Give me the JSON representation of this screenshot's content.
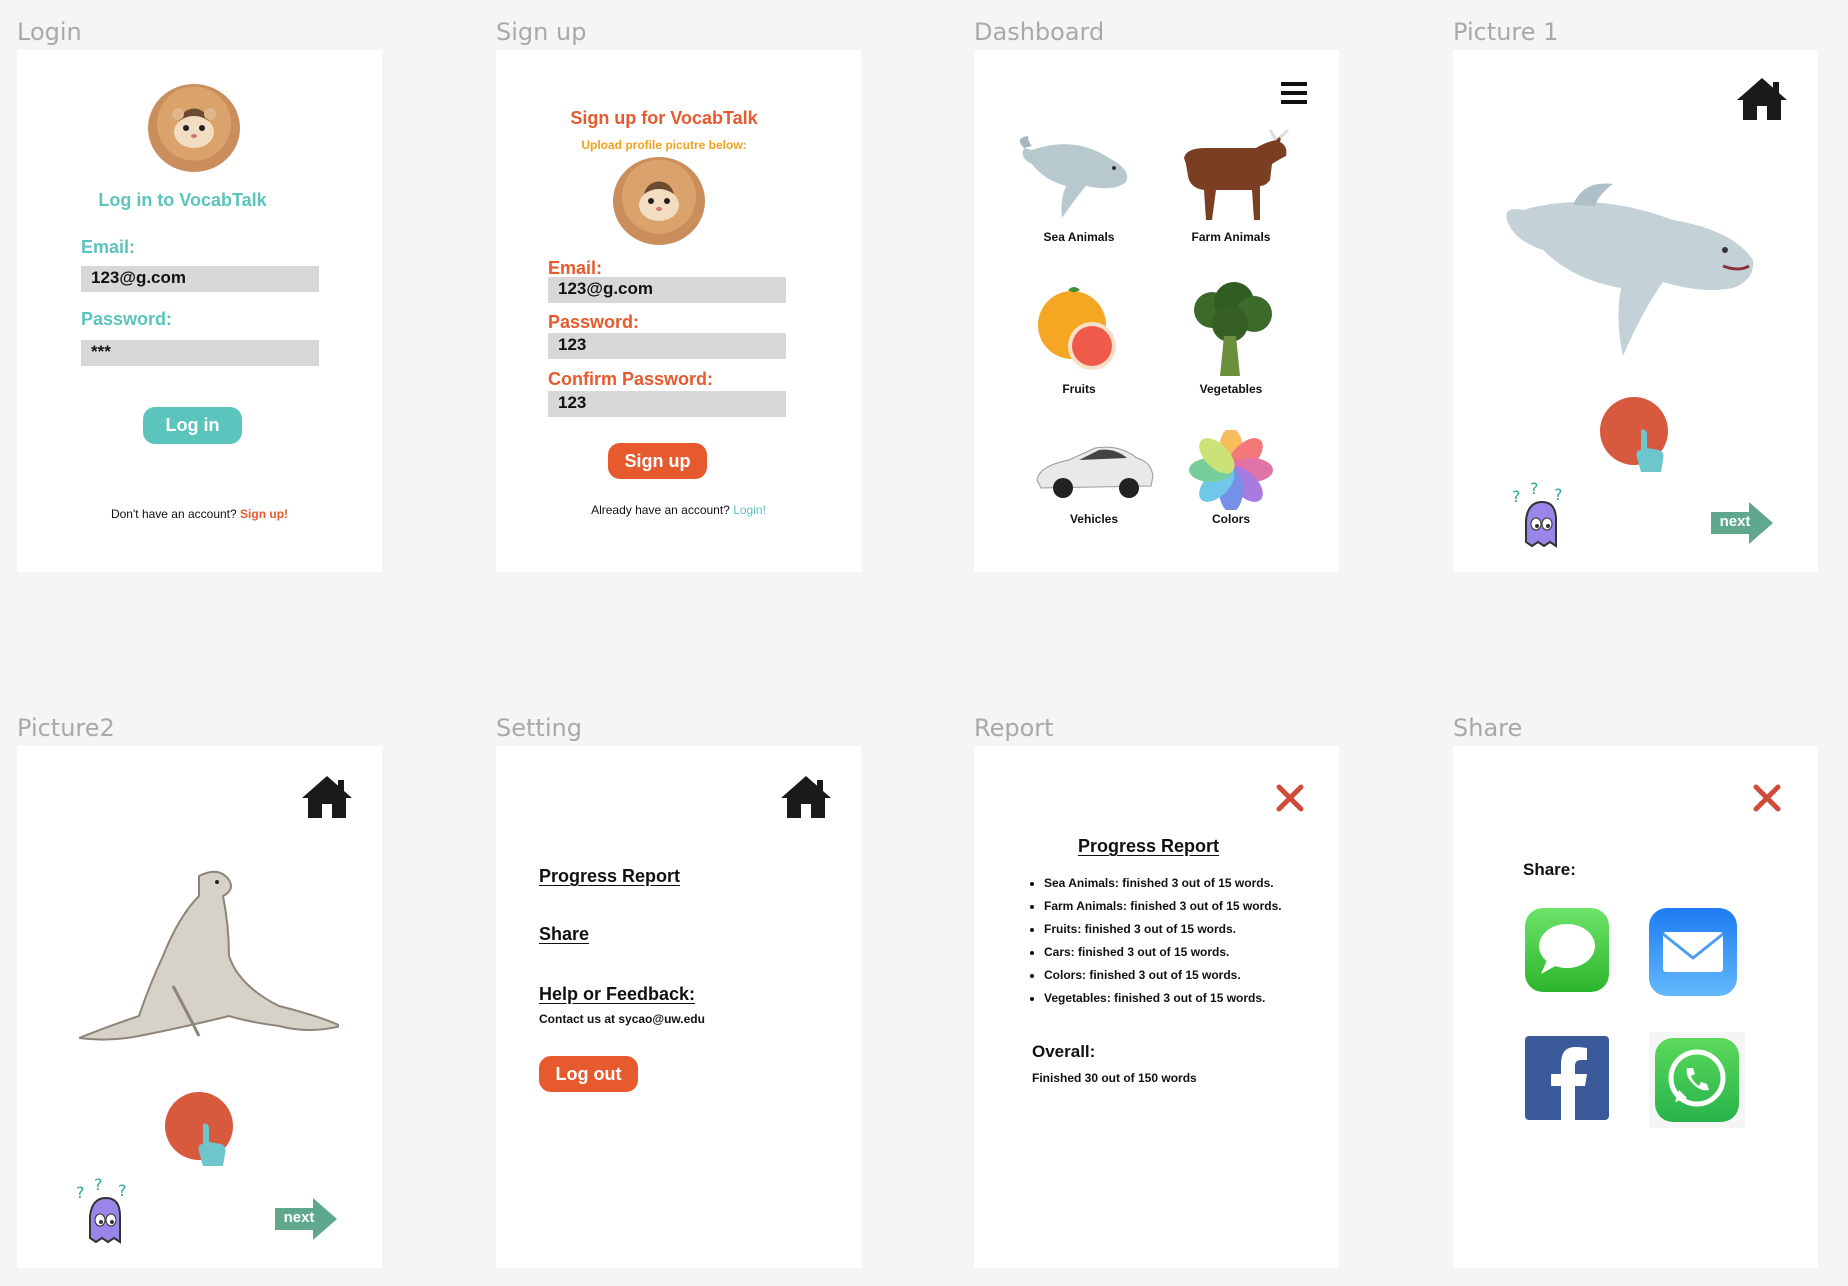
{
  "frames": {
    "login": "Login",
    "signup": "Sign up",
    "dashboard": "Dashboard",
    "picture1": "Picture 1",
    "picture2": "Picture2",
    "setting": "Setting",
    "report": "Report",
    "share": "Share"
  },
  "login": {
    "title": "Log in to VocabTalk",
    "email_label": "Email:",
    "email_value": "123@g.com",
    "password_label": "Password:",
    "password_value": "***",
    "login_button": "Log in",
    "no_account": "Don't have an account?",
    "signup_link": "Sign up!"
  },
  "signup": {
    "title": "Sign up for VocabTalk",
    "upload_hint": "Upload profile picutre below:",
    "email_label": "Email:",
    "email_value": "123@g.com",
    "password_label": "Password:",
    "password_value": "123",
    "confirm_label": "Confirm Password:",
    "confirm_value": "123",
    "signup_button": "Sign up",
    "have_account": "Already have an account?",
    "login_link": "Login!"
  },
  "dashboard": {
    "categories": [
      "Sea Animals",
      "Farm Animals",
      "Fruits",
      "Vegetables",
      "Vehicles",
      "Colors"
    ]
  },
  "picture": {
    "next_label": "next"
  },
  "setting": {
    "progress_report": "Progress Report",
    "share": "Share",
    "help": "Help or Feedback:",
    "contact": "Contact us at sycao@uw.edu",
    "logout_button": "Log out"
  },
  "report": {
    "title": "Progress Report",
    "items": [
      "Sea Animals: finished 3 out of 15 words.",
      "Farm Animals: finished 3 out of 15 words.",
      "Fruits: finished 3 out of 15 words.",
      "Cars: finished 3 out of 15 words.",
      "Colors: finished 3 out of 15 words.",
      "Vegetables: finished 3 out of 15 words."
    ],
    "overall_label": "Overall:",
    "overall_value": "Finished 30 out of 150 words"
  },
  "share": {
    "label": "Share:",
    "apps": [
      "messages-icon",
      "mail-icon",
      "facebook-icon",
      "whatsapp-icon"
    ]
  },
  "colors": {
    "teal": "#5bc4bd",
    "orange": "#e65a2e",
    "next_green": "#5fa88c",
    "close_red": "#d14b38"
  }
}
